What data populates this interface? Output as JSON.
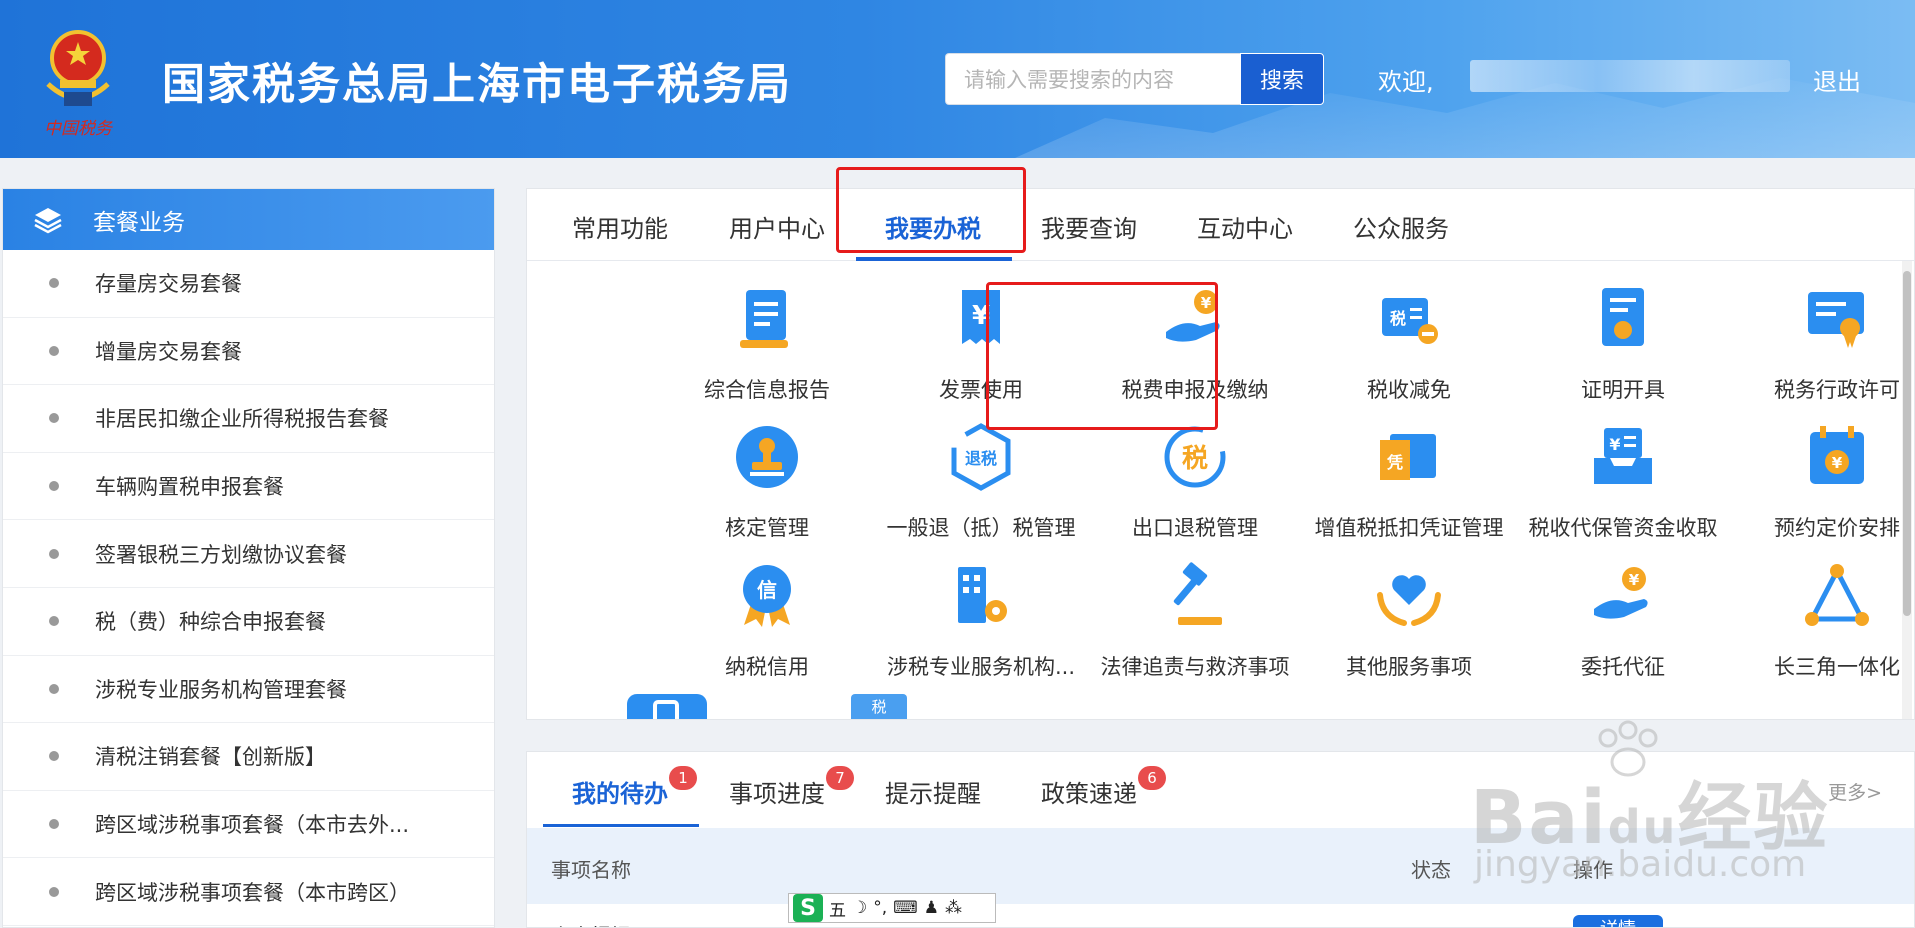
{
  "header": {
    "title": "国家税务总局上海市电子税务局",
    "emblem_text": "中国税务",
    "search_placeholder": "请输入需要搜索的内容",
    "search_button": "搜索",
    "welcome": "欢迎,",
    "logout": "退出"
  },
  "sidebar": {
    "title": "套餐业务",
    "items": [
      "存量房交易套餐",
      "增量房交易套餐",
      "非居民扣缴企业所得税报告套餐",
      "车辆购置税申报套餐",
      "签署银税三方划缴协议套餐",
      "税（费）种综合申报套餐",
      "涉税专业服务机构管理套餐",
      "清税注销套餐【创新版】",
      "跨区域涉税事项套餐（本市去外...",
      "跨区域涉税事项套餐（本市跨区）"
    ]
  },
  "main": {
    "tabs": [
      "常用功能",
      "用户中心",
      "我要办税",
      "我要查询",
      "互动中心",
      "公众服务"
    ],
    "active_tab": "我要办税",
    "grid": [
      {
        "label": "综合信息报告",
        "icon": "report-document-icon"
      },
      {
        "label": "发票使用",
        "icon": "invoice-yuan-icon"
      },
      {
        "label": "税费申报及缴纳",
        "icon": "hand-coin-icon"
      },
      {
        "label": "税收减免",
        "icon": "tax-reduction-icon"
      },
      {
        "label": "证明开具",
        "icon": "certificate-icon"
      },
      {
        "label": "税务行政许可",
        "icon": "license-award-icon"
      },
      {
        "label": "核定管理",
        "icon": "stamp-icon"
      },
      {
        "label": "一般退（抵）税管理",
        "icon": "tax-refund-hexagon-icon"
      },
      {
        "label": "出口退税管理",
        "icon": "export-refund-icon"
      },
      {
        "label": "增值税抵扣凭证管理",
        "icon": "voucher-icon"
      },
      {
        "label": "税收代保管资金收取",
        "icon": "fund-tray-icon"
      },
      {
        "label": "预约定价安排",
        "icon": "calendar-yuan-icon"
      },
      {
        "label": "纳税信用",
        "icon": "credit-medal-icon"
      },
      {
        "label": "涉税专业服务机构...",
        "icon": "building-gear-icon"
      },
      {
        "label": "法律追责与救济事项",
        "icon": "gavel-icon"
      },
      {
        "label": "其他服务事项",
        "icon": "heart-hands-icon"
      },
      {
        "label": "委托代征",
        "icon": "delegate-coin-icon"
      },
      {
        "label": "长三角一体化",
        "icon": "triangle-network-icon"
      }
    ],
    "partial_icon_label": "税"
  },
  "bottom": {
    "tabs": [
      {
        "label": "我的待办",
        "badge": "1"
      },
      {
        "label": "事项进度",
        "badge": "7"
      },
      {
        "label": "提示提醒",
        "badge": ""
      },
      {
        "label": "政策速递",
        "badge": "6"
      }
    ],
    "more": "更多>",
    "columns": [
      "事项名称",
      "状态",
      "操作"
    ],
    "row_partial": "房申报提醒",
    "detail_button": "详情"
  },
  "ime": {
    "logo": "S",
    "mode": "五",
    "items": [
      "☽",
      "°,",
      "⌨",
      "♟",
      "⁂"
    ]
  },
  "watermark": {
    "brand": "Bai",
    "brand2": "du",
    "cn": "经验",
    "url": "jingyan.baidu.com"
  },
  "colors": {
    "accent": "#1a63d6",
    "highlight": "#e61b1b",
    "header": "#2f86e3"
  }
}
